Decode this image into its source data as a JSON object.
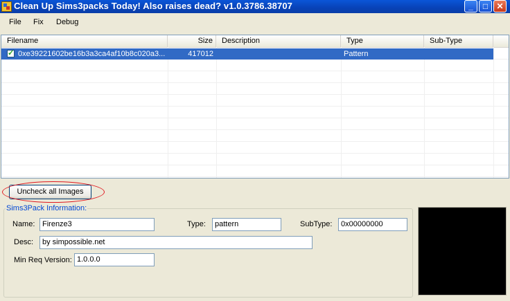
{
  "window": {
    "title": "Clean Up Sims3packs Today! Also raises dead? v1.0.3786.38707",
    "app_icon": "app-icon",
    "controls": {
      "minimize": "_",
      "maximize": "□",
      "close": "✕"
    }
  },
  "menu": {
    "items": [
      "File",
      "Fix",
      "Debug"
    ]
  },
  "list": {
    "columns": [
      "Filename",
      "Size",
      "Description",
      "Type",
      "Sub-Type"
    ],
    "rows": [
      {
        "checked": true,
        "filename": "0xe39221602be16b3a3ca4af10b8c020a3...",
        "size": "417012",
        "description": "",
        "type": "Pattern",
        "subtype": ""
      }
    ],
    "checkmark": "✓"
  },
  "buttons": {
    "uncheck_all": "Uncheck all Images"
  },
  "info": {
    "group_title": "Sims3Pack Information:",
    "name_label": "Name:",
    "name_value": "Firenze3",
    "type_label": "Type:",
    "type_value": "pattern",
    "subtype_label": "SubType:",
    "subtype_value": "0x00000000",
    "desc_label": "Desc:",
    "desc_value": "by simpossible.net",
    "minreq_label": "Min Req Version:",
    "minreq_value": "1.0.0.0"
  },
  "colors": {
    "title_bar": "#0842b7",
    "selection": "#316ac5",
    "highlight_ring": "#e0171f",
    "group_title": "#0046d5"
  }
}
